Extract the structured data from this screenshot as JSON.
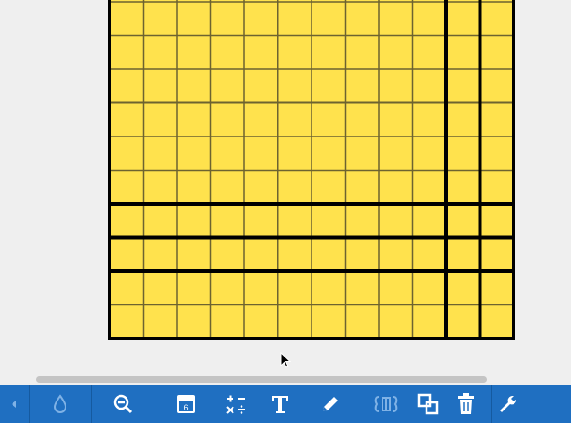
{
  "app": {
    "accent": "#1f6fc1",
    "grid_fill": "#ffe24d",
    "grid_line": "#6d6330",
    "grid_border": "#000000",
    "canvas_bg": "#efefef"
  },
  "base_ten_grid": {
    "columns": 12,
    "rows": 12,
    "thick_after_col": [
      10,
      11
    ],
    "thick_after_row": [
      8,
      9,
      10
    ]
  },
  "toolbar": {
    "tools": [
      {
        "name": "previous-icon",
        "kind": "arrow-left"
      },
      {
        "name": "fill-color-icon",
        "kind": "drop"
      },
      {
        "name": "zoom-out-icon",
        "kind": "zoom-out"
      },
      {
        "name": "tile-piece-icon",
        "kind": "tile"
      },
      {
        "name": "operations-icon",
        "kind": "ops"
      },
      {
        "name": "text-tool-icon",
        "kind": "text"
      },
      {
        "name": "pencil-icon",
        "kind": "pencil"
      },
      {
        "name": "group-icon",
        "kind": "group"
      },
      {
        "name": "duplicate-icon",
        "kind": "duplicate"
      },
      {
        "name": "trash-icon",
        "kind": "trash"
      },
      {
        "name": "settings-icon",
        "kind": "wrench"
      }
    ]
  }
}
